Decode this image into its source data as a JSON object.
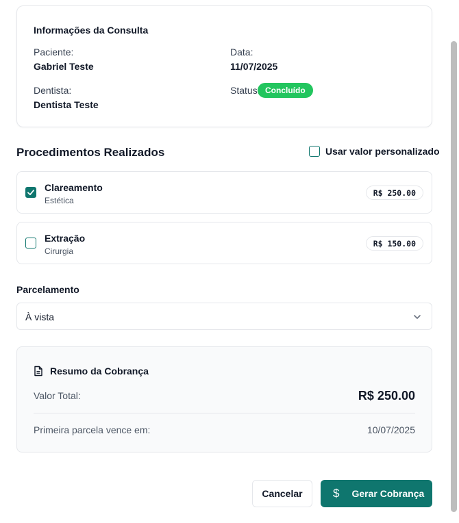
{
  "consultation": {
    "title": "Informações da Consulta",
    "patient_label": "Paciente:",
    "patient_value": "Gabriel Teste",
    "date_label": "Data:",
    "date_value": "11/07/2025",
    "dentist_label": "Dentista:",
    "dentist_value": "Dentista Teste",
    "status_label": "Status:",
    "status_value": "Concluído"
  },
  "procedures": {
    "title": "Procedimentos Realizados",
    "custom_value_label": "Usar valor personalizado",
    "custom_value_checked": false,
    "items": [
      {
        "name": "Clareamento",
        "category": "Estética",
        "price": "R$ 250.00",
        "checked": true
      },
      {
        "name": "Extração",
        "category": "Cirurgia",
        "price": "R$ 150.00",
        "checked": false
      }
    ]
  },
  "installments": {
    "label": "Parcelamento",
    "selected": "À vista"
  },
  "summary": {
    "title": "Resumo da Cobrança",
    "total_label": "Valor Total:",
    "total_value": "R$ 250.00",
    "first_due_label": "Primeira parcela vence em:",
    "first_due_value": "10/07/2025"
  },
  "actions": {
    "cancel_label": "Cancelar",
    "generate_label": "Gerar Cobrança",
    "generate_icon": "$"
  },
  "colors": {
    "accent": "#0f766e",
    "status_success": "#22c55e"
  },
  "icons": {
    "summary": "document-icon",
    "select": "chevron-down-icon",
    "check": "check-icon",
    "generate": "dollar-icon"
  }
}
